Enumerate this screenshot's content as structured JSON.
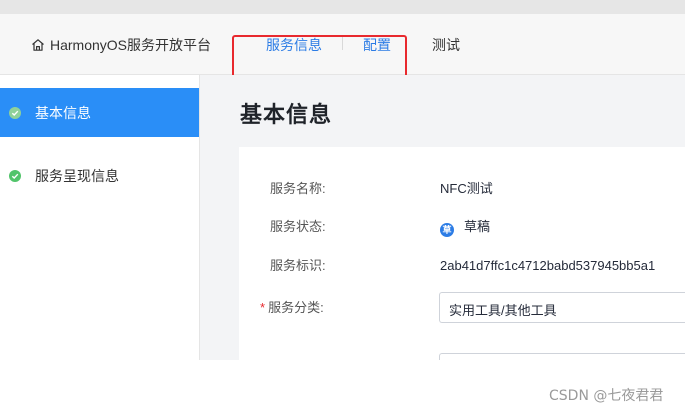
{
  "header": {
    "brand_title": "HarmonyOS服务开放平台",
    "brand_icon": "home-icon",
    "nav": [
      {
        "label": "服务信息",
        "state": "active"
      },
      {
        "label": "配置",
        "state": "active"
      },
      {
        "label": "测试",
        "state": "normal"
      }
    ],
    "highlight_color": "#e8292e",
    "accent_color": "#2c7ce5"
  },
  "sidebar": {
    "items": [
      {
        "label": "基本信息",
        "active": true,
        "icon": "check-circle-icon"
      },
      {
        "label": "服务呈现信息",
        "active": false,
        "icon": "check-circle-icon"
      }
    ],
    "active_color": "#2a8ef7"
  },
  "main": {
    "title": "基本信息",
    "fields": [
      {
        "label": "服务名称:",
        "value": "NFC测试",
        "required": false
      },
      {
        "label": "服务状态:",
        "value": "草稿",
        "badge": "草",
        "required": false
      },
      {
        "label": "服务标识:",
        "value": "2ab41d7ffc1c4712babd537945bb5a1",
        "required": false
      },
      {
        "label": "服务分类:",
        "value": "实用工具/其他工具",
        "required": true
      }
    ],
    "required_mark": "*"
  },
  "watermark": "CSDN @七夜君君"
}
